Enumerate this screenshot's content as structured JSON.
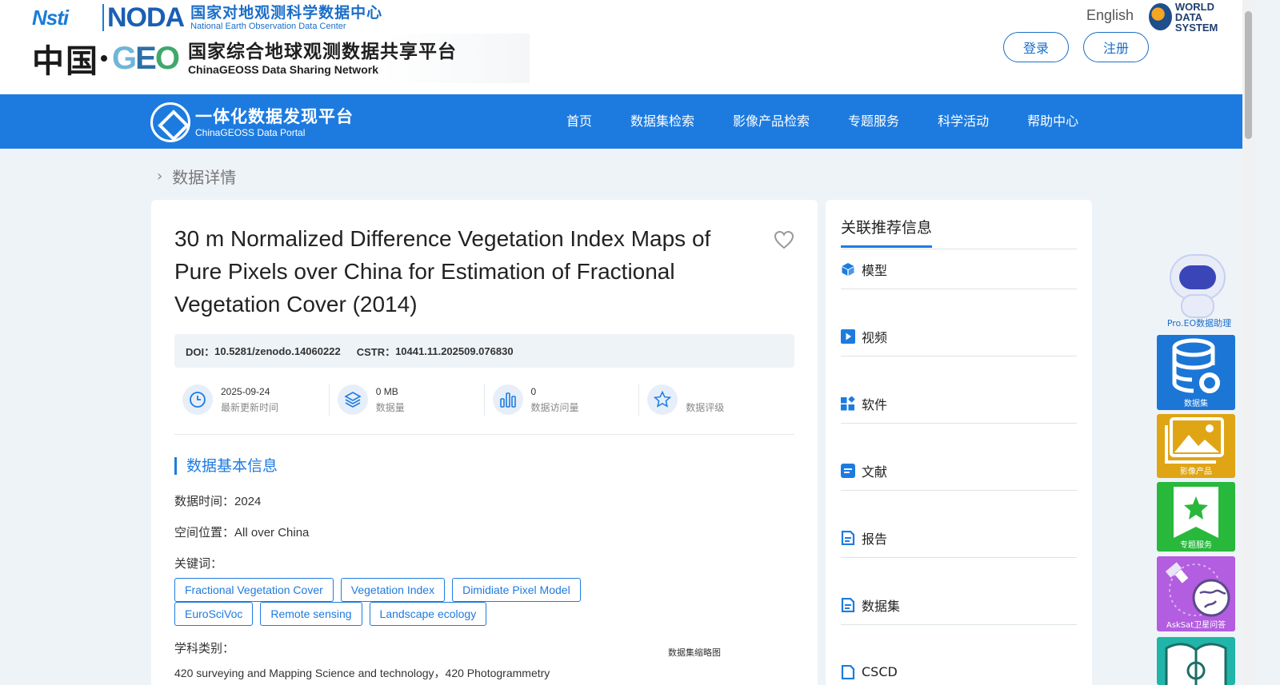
{
  "header": {
    "noda_mark": "NODA",
    "nsti_mark": "Nsti",
    "noda_cn": "国家对地观测科学数据中心",
    "noda_en": "National Earth Observation Data Center",
    "china_mark": "中国",
    "geo_mark": "GEO",
    "geoss_cn": "国家综合地球观测数据共享平台",
    "geoss_en": "ChinaGEOSS Data Sharing Network",
    "language": "English",
    "wds_line1": "WORLD",
    "wds_line2": "DATA SYSTEM",
    "login": "登录",
    "register": "注册"
  },
  "nav": {
    "portal_cn": "一体化数据发现平台",
    "portal_en": "ChinaGEOSS Data Portal",
    "items": [
      "首页",
      "数据集检索",
      "影像产品检索",
      "专题服务",
      "科学活动",
      "帮助中心"
    ]
  },
  "breadcrumb": {
    "current": "数据详情"
  },
  "dataset": {
    "title": "30 m Normalized Difference Vegetation Index Maps of Pure Pixels over China for Estimation of Fractional Vegetation Cover (2014)",
    "doi_label": "DOI：",
    "doi": "10.5281/zenodo.14060222",
    "cstr_label": "CSTR：",
    "cstr": "10441.11.202509.076830",
    "stats": [
      {
        "value": "2025-09-24",
        "label": "最新更新时间",
        "icon": "clock-icon"
      },
      {
        "value": "0 MB",
        "label": "数据量",
        "icon": "layers-icon"
      },
      {
        "value": "0",
        "label": "数据访问量",
        "icon": "bar-chart-icon"
      },
      {
        "value": "",
        "label": "数据评级",
        "icon": "star-icon"
      }
    ],
    "section_title": "数据基本信息",
    "time_label": "数据时间：",
    "time_value": "2024",
    "location_label": "空间位置：",
    "location_value": "All over China",
    "keywords_label": "关键词：",
    "keywords": [
      "Fractional Vegetation Cover",
      "Vegetation Index",
      "Dimidiate Pixel Model",
      "EuroSciVoc",
      "Remote sensing",
      "Landscape ecology"
    ],
    "category_label": "学科类别：",
    "category_value": "420 surveying and Mapping Science and technology，420 Photogrammetry",
    "thumbnail_label": "数据集缩略图"
  },
  "side": {
    "title": "关联推荐信息",
    "items": [
      "模型",
      "视频",
      "软件",
      "文献",
      "报告",
      "数据集",
      "CSCD"
    ]
  },
  "widgets": {
    "assistant": "Pro.EO数据助理",
    "dataset": "数据集",
    "image": "影像产品",
    "topic": "专题服务",
    "asksat": "AskSat卫星问答"
  },
  "colors": {
    "primary": "#1d7be0",
    "page_bg": "#eef3f8",
    "widget_dataset": "#1c76d6",
    "widget_image": "#e0a514",
    "widget_topic": "#28b83c",
    "widget_asksat": "#b35de0",
    "widget_book": "#20b5a8"
  }
}
